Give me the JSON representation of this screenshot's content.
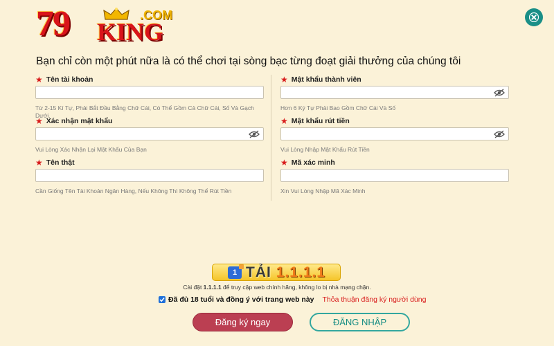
{
  "logo": {
    "numeral": "79",
    "word": "KING",
    "suffix": ".COM"
  },
  "headline": "Bạn chỉ còn một phút nữa là có thể chơi tại sòng bạc từng đoạt giải thưởng của chúng tôi",
  "form": {
    "left": [
      {
        "label": "Tên tài khoản",
        "value": "",
        "hint": "Từ 2-15 Kí Tự, Phải Bắt Đầu Bằng Chữ Cái, Có Thể Gồm Cả Chữ Cái, Số Và Gạch Dưới.",
        "has_eye": false
      },
      {
        "label": "Xác nhận mật khẩu",
        "value": "",
        "hint": "Vui Lòng Xác Nhận Lại Mật Khẩu Của Bạn",
        "has_eye": true
      },
      {
        "label": "Tên thật",
        "value": "",
        "hint": "Cần Giống Tên Tài Khoản Ngân Hàng, Nếu Không Thì Không Thể Rút Tiền",
        "has_eye": false
      }
    ],
    "right": [
      {
        "label": "Mật khẩu thành viên",
        "value": "",
        "hint": "Hơn 6 Ký Tự Phải Bao Gồm Chữ Cái Và Số",
        "has_eye": true
      },
      {
        "label": "Mật khẩu rút tiền",
        "value": "",
        "hint": "Vui Lòng Nhập Mật Khẩu Rút Tiền",
        "has_eye": true
      },
      {
        "label": "Mã xác minh",
        "value": "",
        "hint": "Xin Vui Lòng Nhập Mã Xác Minh",
        "has_eye": false
      }
    ]
  },
  "download_banner": {
    "badge": "1",
    "prefix": "TẢI ",
    "version": "1.1.1.1"
  },
  "install_note": {
    "before": "Cài đặt ",
    "app": "1.1.1.1",
    "after": " để truy cập web chính hãng, không lo bị nhà mạng chặn."
  },
  "agree": {
    "checked": true,
    "text": "Đã đủ 18 tuổi và đồng ý với trang web này",
    "terms_link": "Thỏa thuận đăng ký người dùng"
  },
  "buttons": {
    "register": "Đăng ký ngay",
    "login": "ĐĂNG NHẬP"
  },
  "colors": {
    "background": "#fbf2d8",
    "required_star": "#d81b1b",
    "register_button": "#bb3f52",
    "login_border": "#33a79f",
    "close_button": "#1a8f87"
  }
}
